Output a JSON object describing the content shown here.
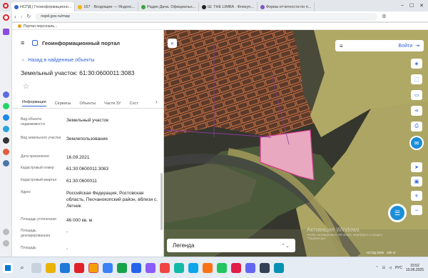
{
  "browser": {
    "tabs": [
      "НСПД | Геоинформационн...",
      "167 · Входящие — Яндекс...",
      "Радио Дача. Официальн...",
      "Ш: THE LIMBA · Флекуп...",
      "Форма отчетности по п..."
    ],
    "address": "nspd.gov.ru/map",
    "bookmark": "Портал персональ..."
  },
  "panel": {
    "portal_title": "Геоинформационный портал",
    "back_link": "Назад в найденные объекты",
    "title": "Земельный участок: 61:30:0600011:3083",
    "tabs": [
      "Информация",
      "Сервисы",
      "Объекты",
      "Части ЗУ",
      "Сост"
    ],
    "rows": [
      {
        "label": "Вид объекта недвижимости",
        "value": "Земельный участок"
      },
      {
        "label": "Вид земельного участка",
        "value": "Землепользование"
      },
      {
        "label": "Дата присвоения",
        "value": "16.09.2021"
      },
      {
        "label": "Кадастровый номер",
        "value": "61:30:0600011:3083"
      },
      {
        "label": "Кадастровый квартал",
        "value": "61:30:0600011"
      },
      {
        "label": "Адрес",
        "value": "Российская Федерация, Ростовская область, Песчанокопский район, вблизи с. Летник"
      },
      {
        "label": "Площадь уточненная",
        "value": "46 000 кв. м"
      },
      {
        "label": "Площадь декларированная",
        "value": "-"
      },
      {
        "label": "Площадь",
        "value": "-"
      }
    ]
  },
  "map": {
    "login": "Войти",
    "legend": "Легенда",
    "watermark_title": "Активация Windows",
    "watermark_sub": "Чтобы активировать Windows, перейдите в раздел \"Параметры\".",
    "scale": "100 m",
    "attribution": "НСПД 2025"
  },
  "taskbar": {
    "time": "15:52",
    "date": "10.06.2025",
    "lang": "РУС"
  },
  "colors": {
    "accent": "#2f63d6",
    "parcel_selected": "#e8a9c0",
    "parcel_stroke": "#d23a8a",
    "field": "#b5ae6a"
  }
}
